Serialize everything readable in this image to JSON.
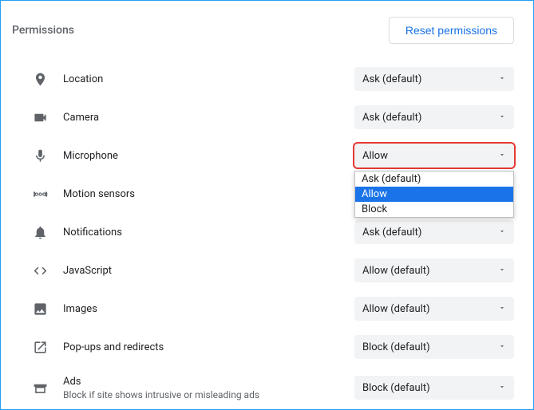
{
  "header": {
    "title": "Permissions",
    "reset_label": "Reset permissions"
  },
  "dropdown": {
    "options": [
      "Ask (default)",
      "Allow",
      "Block"
    ],
    "selected": "Allow"
  },
  "rows": [
    {
      "icon": "location-icon",
      "label": "Location",
      "value": "Ask (default)",
      "highlight": false,
      "open": false
    },
    {
      "icon": "camera-icon",
      "label": "Camera",
      "value": "Ask (default)",
      "highlight": false,
      "open": false
    },
    {
      "icon": "microphone-icon",
      "label": "Microphone",
      "value": "Allow",
      "highlight": true,
      "open": true
    },
    {
      "icon": "motion-icon",
      "label": "Motion sensors",
      "value": "",
      "highlight": false,
      "open": false,
      "hide_select": true
    },
    {
      "icon": "notifications-icon",
      "label": "Notifications",
      "value": "Ask (default)",
      "highlight": false,
      "open": false
    },
    {
      "icon": "javascript-icon",
      "label": "JavaScript",
      "value": "Allow (default)",
      "highlight": false,
      "open": false
    },
    {
      "icon": "images-icon",
      "label": "Images",
      "value": "Allow (default)",
      "highlight": false,
      "open": false
    },
    {
      "icon": "popups-icon",
      "label": "Pop-ups and redirects",
      "value": "Block (default)",
      "highlight": false,
      "open": false
    },
    {
      "icon": "ads-icon",
      "label": "Ads",
      "sublabel": "Block if site shows intrusive or misleading ads",
      "value": "Block (default)",
      "highlight": false,
      "open": false
    }
  ]
}
